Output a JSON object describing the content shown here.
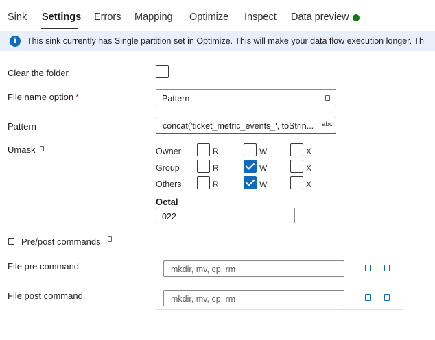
{
  "tabs": [
    {
      "label": "Sink"
    },
    {
      "label": "Settings",
      "active": true
    },
    {
      "label": "Errors"
    },
    {
      "label": "Mapping"
    },
    {
      "label": "Optimize"
    },
    {
      "label": "Inspect"
    },
    {
      "label": "Data preview"
    }
  ],
  "colors": {
    "accent": "#0f6cbd",
    "status_ok": "#107c10",
    "banner_bg": "#e8f1fb",
    "required": "#c50f1f"
  },
  "banner": {
    "icon": "info-icon",
    "icon_glyph": "i",
    "text": "This sink currently has Single partition set in Optimize. This will make your data flow execution longer. Th"
  },
  "form": {
    "clear_folder": {
      "label": "Clear the folder",
      "checked": false
    },
    "file_name_option": {
      "label": "File name option",
      "required_mark": "*",
      "value": "Pattern"
    },
    "pattern": {
      "label": "Pattern",
      "value": "concat('ticket_metric_events_', toStrin...",
      "type_badge": "abc"
    },
    "umask": {
      "label": "Umask",
      "rows": [
        {
          "label": "Owner",
          "r": false,
          "w": false,
          "x": false
        },
        {
          "label": "Group",
          "r": false,
          "w": true,
          "x": false
        },
        {
          "label": "Others",
          "r": false,
          "w": true,
          "x": false
        }
      ],
      "letters": {
        "r": "R",
        "w": "W",
        "x": "X"
      },
      "octal_label": "Octal",
      "octal_value": "022"
    },
    "pre_post": {
      "label": "Pre/post commands",
      "expanded": true
    },
    "file_pre_command": {
      "label": "File pre command",
      "placeholder": "mkdir, mv, cp, rm"
    },
    "file_post_command": {
      "label": "File post command",
      "placeholder": "mkdir, mv, cp, rm"
    }
  }
}
